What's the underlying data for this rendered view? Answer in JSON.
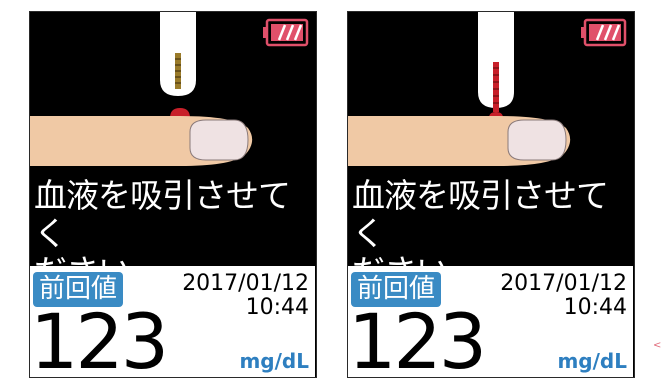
{
  "screens": [
    {
      "message": "血液を吸引させてく\nださい",
      "last_value_label": "前回値",
      "date": "2017/01/12",
      "time": "10:44",
      "glucose_value": "123",
      "unit": "mg/dL",
      "battery_level": 1.0,
      "strip_state": "before-sampling"
    },
    {
      "message": "血液を吸引させてく\nださい",
      "last_value_label": "前回値",
      "date": "2017/01/12",
      "time": "10:44",
      "glucose_value": "123",
      "unit": "mg/dL",
      "battery_level": 1.0,
      "strip_state": "filled-with-blood"
    }
  ],
  "edge_mark": "<",
  "colors": {
    "screen_background": "#000000",
    "battery": "#e0506a",
    "blood": "#c8202a",
    "finger_skin": "#f0c9a5",
    "nail": "#efe2e3",
    "badge": "#3a8bc4",
    "unit": "#2e7fc0"
  }
}
